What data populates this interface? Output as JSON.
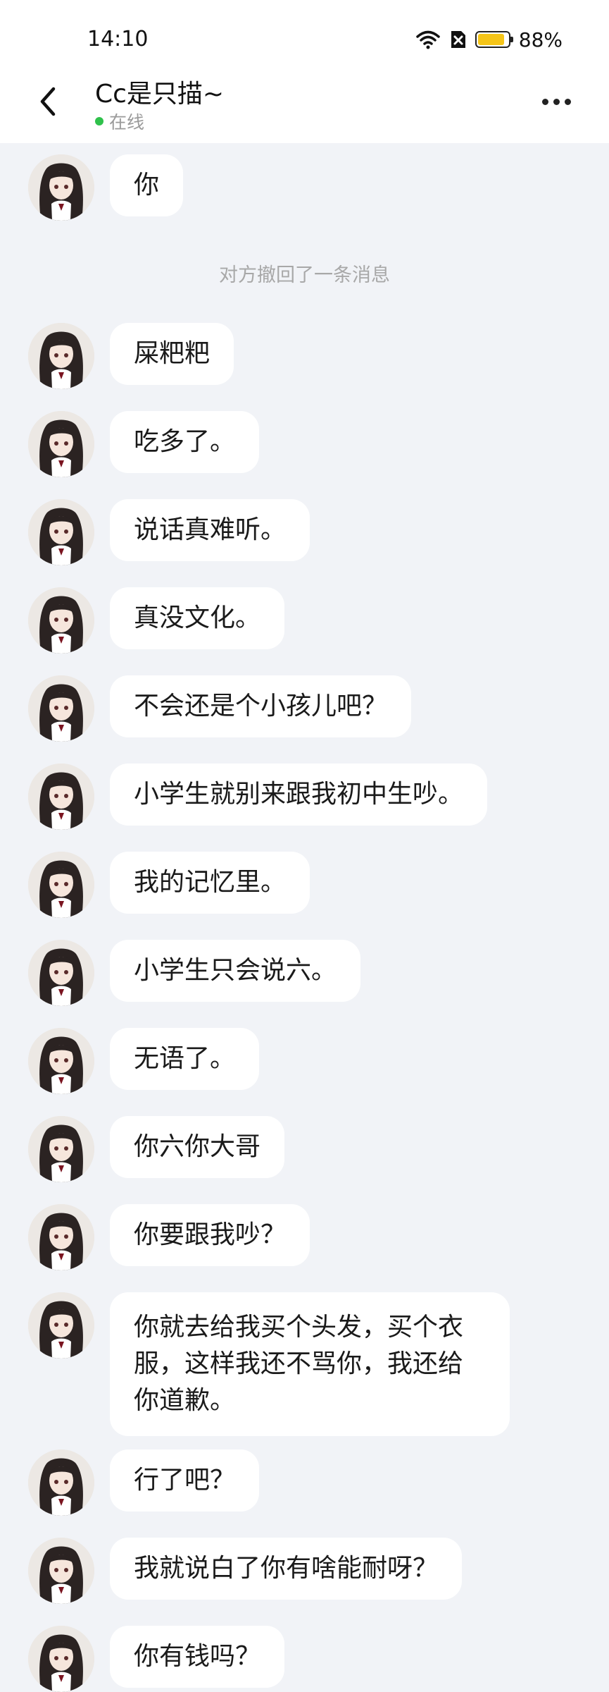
{
  "status_bar": {
    "time": "14:10",
    "battery": "88%",
    "battery_level": 0.88
  },
  "header": {
    "title": "Cc是只描~",
    "presence": "在线"
  },
  "system_notice": "对方撤回了一条消息",
  "messages": [
    "你",
    "屎粑粑",
    "吃多了。",
    "说话真难听。",
    "真没文化。",
    "不会还是个小孩儿吧？",
    "小学生就别来跟我初中生吵。",
    "我的记忆里。",
    "小学生只会说六。",
    "无语了。",
    "你六你大哥",
    "你要跟我吵？",
    "你就去给我买个头发，买个衣服，这样我还不骂你，我还给你道歉。",
    "行了吧？",
    "我就说白了你有啥能耐呀？",
    "你有钱吗？"
  ],
  "colors": {
    "accent_online": "#2fc14b",
    "bubble": "#ffffff",
    "background": "#f1f3f7"
  }
}
